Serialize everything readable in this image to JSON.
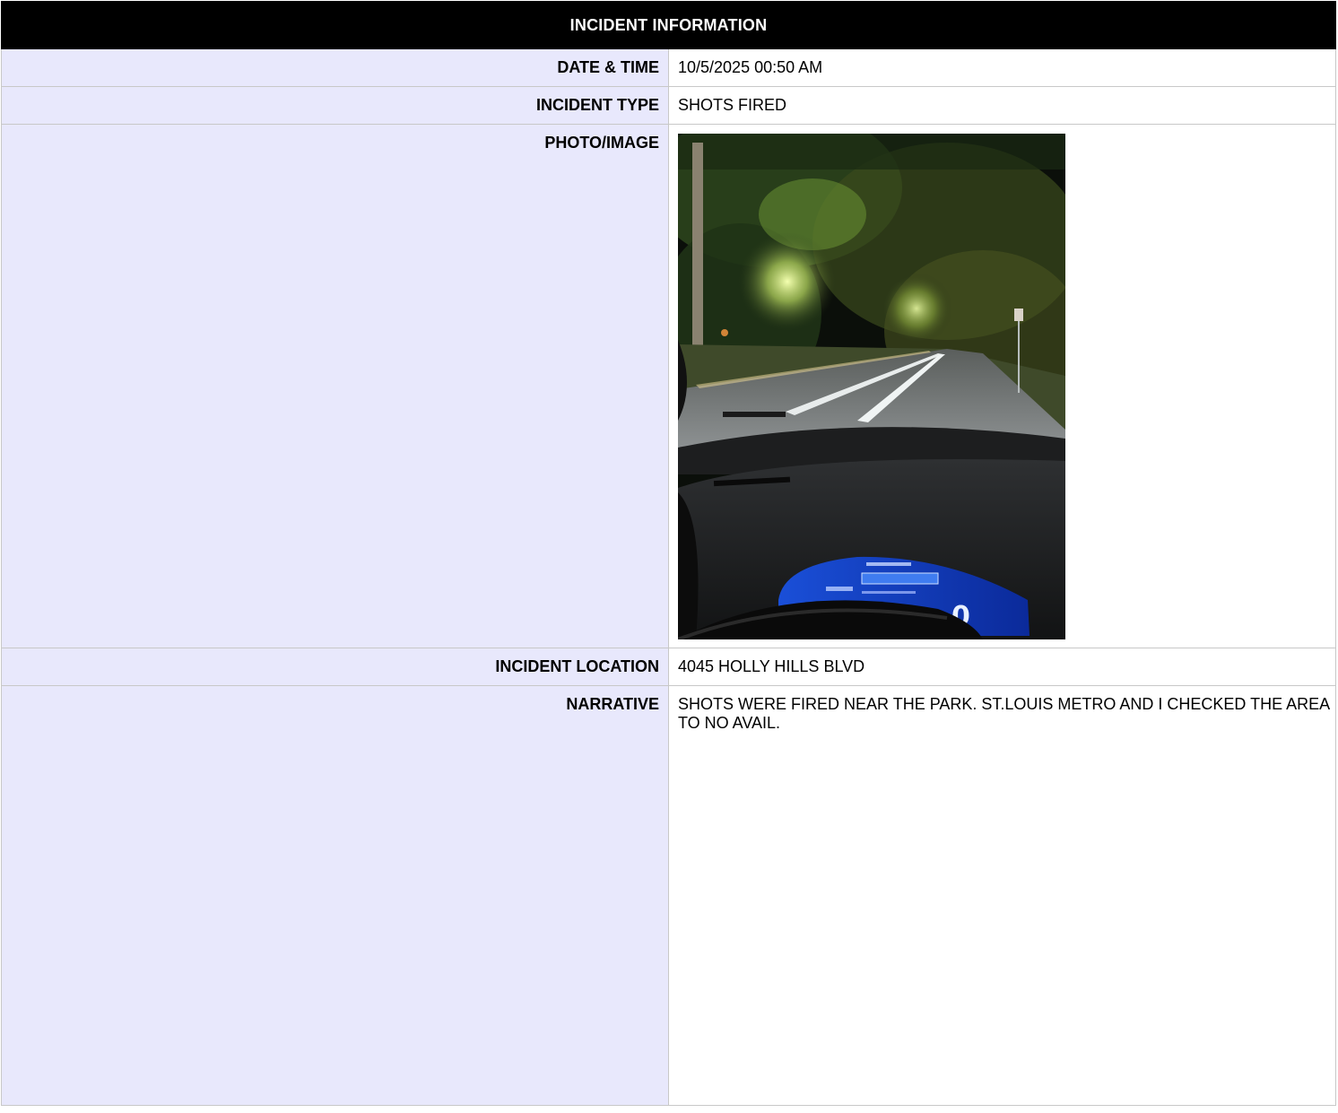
{
  "header": {
    "title": "INCIDENT INFORMATION"
  },
  "rows": {
    "date_time": {
      "label": "DATE & TIME",
      "value": "10/5/2025 00:50 AM"
    },
    "incident_type": {
      "label": "INCIDENT TYPE",
      "value": "SHOTS FIRED"
    },
    "photo": {
      "label": "PHOTO/IMAGE",
      "image": "night-road-dashcam-photo"
    },
    "location": {
      "label": "INCIDENT LOCATION",
      "value": "4045 HOLLY HILLS BLVD"
    },
    "narrative": {
      "label": "NARRATIVE",
      "value": "SHOTS WERE FIRED NEAR THE PARK. ST.LOUIS METRO AND I CHECKED THE AREA TO NO AVAIL."
    }
  },
  "photo_readout": "0",
  "colors": {
    "header_bg": "#000000",
    "label_bg": "#e8e8fc",
    "border": "#c8c8c8"
  }
}
